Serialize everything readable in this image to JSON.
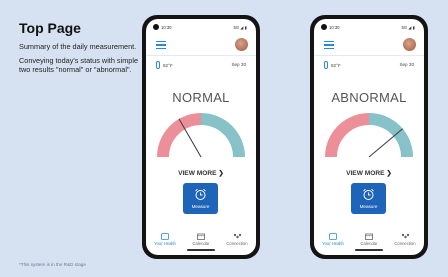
{
  "slide": {
    "title": "Top Page",
    "desc1": "Summary of the daily measurement.",
    "desc2": "Conveying today's status with simple two results \"normal\" or \"abnormal\".",
    "footnote": "*This system is in the R&D stage"
  },
  "phones": [
    {
      "time": "10:30",
      "system_icons": "5G ◢ ▮",
      "temperature": "82°F",
      "date": "Sep 30",
      "status": "NORMAL",
      "needle_angle_deg": 60,
      "view_more": "VIEW MORE",
      "measure_label": "Measure",
      "tabs": [
        "Your Health",
        "Calendar",
        "Connection"
      ]
    },
    {
      "time": "10:30",
      "system_icons": "5G ◢ ▮",
      "temperature": "82°F",
      "date": "Sep 30",
      "status": "ABNORMAL",
      "needle_angle_deg": 140,
      "view_more": "VIEW MORE",
      "measure_label": "Measure",
      "tabs": [
        "Your Health",
        "Calendar",
        "Connection"
      ]
    }
  ],
  "colors": {
    "abnormal_zone": "#ec8f99",
    "normal_zone": "#86c2c8",
    "accent": "#2b8ad6",
    "measure_button": "#1e64b8"
  }
}
